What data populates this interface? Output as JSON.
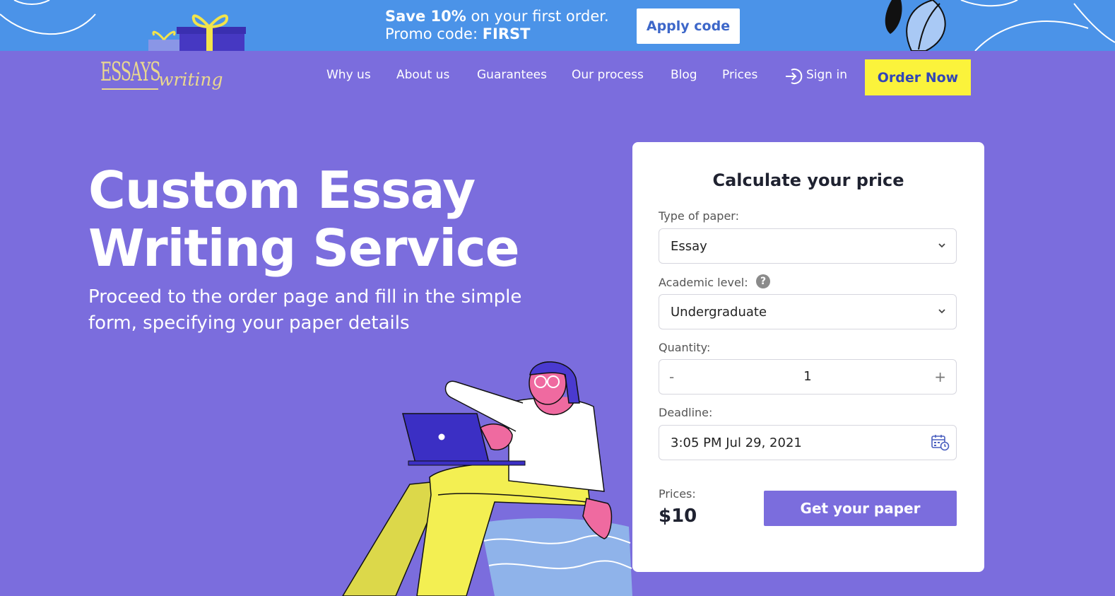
{
  "promo": {
    "save": "Save 10%",
    "rest": " on your first order.",
    "promo_label": "Promo code: ",
    "code": "FIRST",
    "apply_label": "Apply code"
  },
  "logo": {
    "top": "ESSAYS",
    "bottom": "writing"
  },
  "nav": {
    "items": [
      "Why us",
      "About us",
      "Guarantees",
      "Our process",
      "Blog",
      "Prices"
    ],
    "signin": "Sign in",
    "order": "Order Now"
  },
  "hero": {
    "title_line1": "Custom Essay",
    "title_line2": "Writing Service",
    "subtitle": "Proceed to the order page and fill in the simple form, specifying your paper details"
  },
  "calculator": {
    "title": "Calculate your price",
    "paper_label": "Type of paper:",
    "paper_value": "Essay",
    "level_label": "Academic level:",
    "level_help": "?",
    "level_value": "Undergraduate",
    "quantity_label": "Quantity:",
    "quantity_minus": "-",
    "quantity_value": "1",
    "quantity_plus": "+",
    "deadline_label": "Deadline:",
    "deadline_value": "3:05 PM Jul 29, 2021",
    "prices_label": "Prices:",
    "price_value": "$10",
    "get_label": "Get your paper"
  },
  "colors": {
    "background": "#7b6ddd",
    "banner": "#4b93e8",
    "order_button": "#fbf33b",
    "accent_text": "#3246b6"
  }
}
